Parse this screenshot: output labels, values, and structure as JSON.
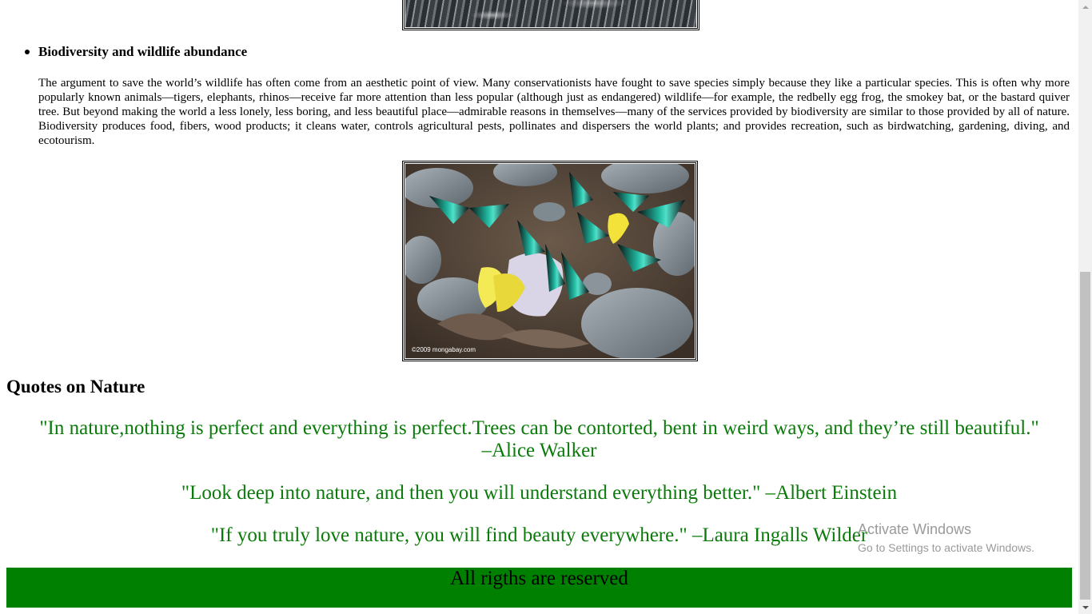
{
  "section": {
    "heading": "Biodiversity and wildlife abundance",
    "paragraph": "The argument to save the world’s wildlife has often come from an aesthetic point of view. Many conservationists have fought to save species simply because they like a particular species. This is often why more popularly known animals—tigers, elephants, rhinos—receive far more attention than less popular (although just as endangered) wildlife—for example, the redbelly egg frog, the smokey bat, or the bastard quiver tree. But beyond making the world a less lonely, less boring, and less beautiful place—admirable reasons in themselves—many of the services provided by biodiversity are similar to those provided by all of nature. Biodiversity produces food, fibers, wood products; it cleans water, controls agricultural pests, pollinates and dispersers the world plants; and provides recreation, such as birdwatching, gardening, diving, and ecotourism.",
    "image_credit": "©2009 mongabay.com"
  },
  "quotes": {
    "heading": "Quotes on Nature",
    "items": [
      "\"In nature,nothing is perfect and everything is perfect.Trees can be contorted, bent in weird ways, and they’re still beautiful.\" –Alice Walker",
      "\"Look deep into nature, and then you will understand everything better.\" –Albert Einstein",
      "\"If you truly love nature, you will find beauty everywhere.\" –Laura Ingalls Wilder"
    ],
    "color": "#0a7a0a"
  },
  "footer": {
    "text": "All rigths are reserved",
    "background": "#008000"
  },
  "watermark": {
    "title": "Activate Windows",
    "subtitle": "Go to Settings to activate Windows."
  }
}
